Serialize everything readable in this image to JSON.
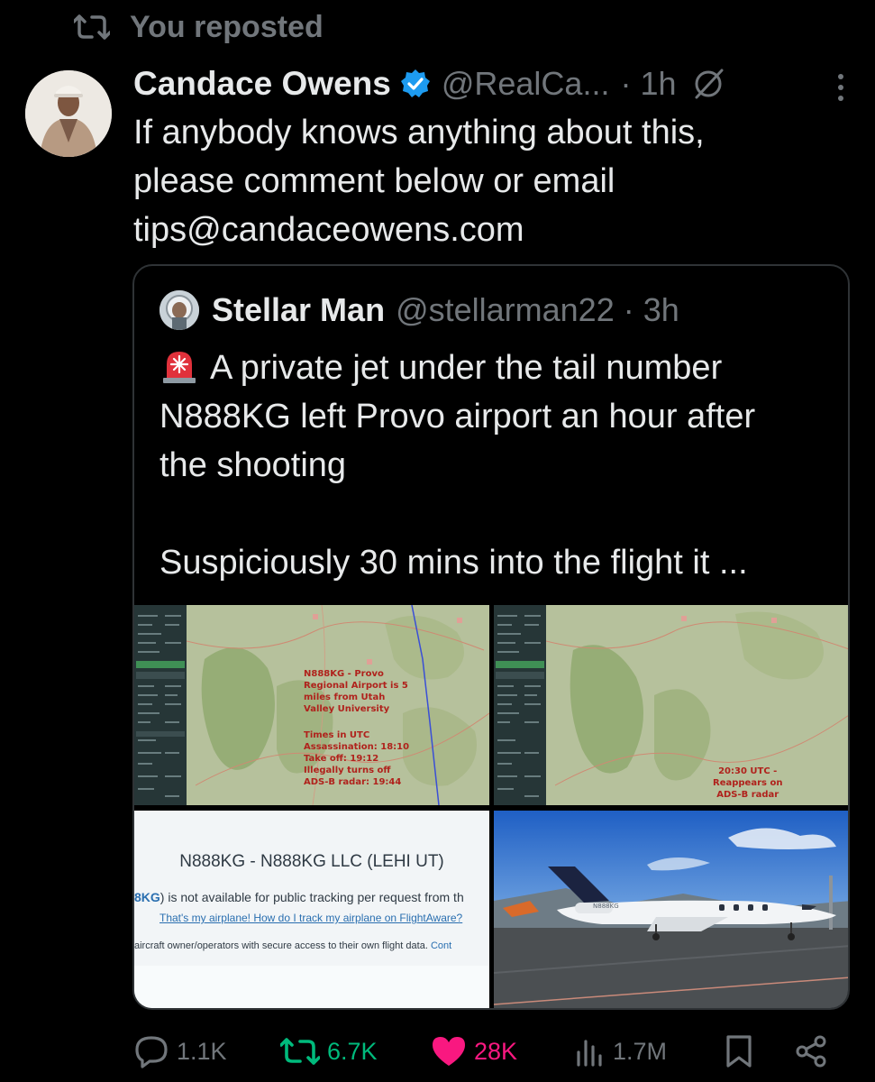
{
  "repost_banner": {
    "label": "You reposted"
  },
  "tweet": {
    "author_name": "Candace Owens",
    "author_handle": "@RealCa...",
    "time": "· 1h",
    "text_lines": [
      "If anybody knows anything about this,",
      "please comment below or email",
      "tips@candaceowens.com"
    ]
  },
  "quoted": {
    "author_name": "Stellar Man",
    "author_handle": "@stellarman22 · 3h",
    "text_lines": [
      "A private jet under the tail number",
      "N888KG left Provo airport an hour after",
      "the shooting",
      "",
      "Suspiciously 30 mins into the flight it ..."
    ],
    "images": {
      "map1_note1": "N888KG - Provo\nRegional Airport is 5\nmiles from Utah\nValley University",
      "map1_note2": "Times in UTC\nAssassination: 18:10\nTake off: 19:12\nIllegally turns off\nADS-B radar: 19:44",
      "map2_note": "20:30 UTC -\nReappears on\nADS-B radar",
      "flightaware_title": "N888KG - N888KG LLC (LEHI UT)",
      "flightaware_link_fragment": "8KG",
      "flightaware_line1": ") is not available for public tracking per request from th",
      "flightaware_link2": "That's my airplane! How do I track my airplane on FlightAware?",
      "flightaware_line3": "aircraft owner/operators with secure access to their own flight data. ",
      "flightaware_link3": "Cont",
      "jet_tail_mark": "N888KG"
    }
  },
  "actions": {
    "replies": "1.1K",
    "reposts": "6.7K",
    "likes": "28K",
    "views": "1.7M"
  },
  "colors": {
    "background": "#000000",
    "secondary_text": "#71767b",
    "repost_green": "#00ba7c",
    "like_pink": "#f91880",
    "verified_blue": "#1d9bf0"
  }
}
